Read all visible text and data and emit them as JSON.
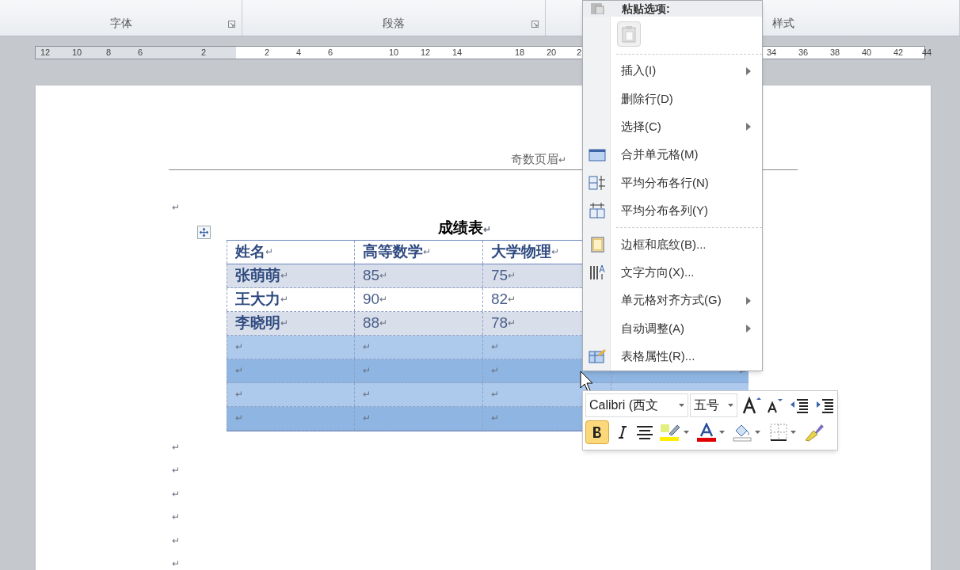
{
  "ribbon": {
    "groups": [
      {
        "label": "字体",
        "launcher": true
      },
      {
        "label": "段落",
        "launcher": true
      },
      {
        "label": "样式",
        "launcher": false
      }
    ]
  },
  "ruler": {
    "labels": [
      "12",
      "10",
      "8",
      "6",
      "2",
      "2",
      "4",
      "6",
      "10",
      "12",
      "14",
      "18",
      "20",
      "2",
      "34",
      "36",
      "38",
      "40",
      "42",
      "44"
    ]
  },
  "document": {
    "header": {
      "text": "奇数页眉",
      "mark": "↵"
    },
    "marks_before": [
      "↵"
    ],
    "table": {
      "title": "成绩表",
      "title_mark": "↵",
      "rows": [
        {
          "kind": "header",
          "selected": false,
          "cells": [
            {
              "text": "姓名",
              "mark": "↵"
            },
            {
              "text": "高等数学",
              "mark": "↵"
            },
            {
              "text": "大学物理",
              "mark": "↵"
            }
          ]
        },
        {
          "kind": "data",
          "selected": false,
          "cells": [
            {
              "text": "张萌萌",
              "mark": "↵"
            },
            {
              "text": "85",
              "mark": "↵"
            },
            {
              "text": "75",
              "mark": "↵"
            }
          ]
        },
        {
          "kind": "data",
          "selected": false,
          "cells": [
            {
              "text": "王大力",
              "mark": "↵"
            },
            {
              "text": "90",
              "mark": "↵"
            },
            {
              "text": "82",
              "mark": "↵"
            }
          ]
        },
        {
          "kind": "data",
          "selected": false,
          "cells": [
            {
              "text": "李晓明",
              "mark": "↵"
            },
            {
              "text": "88",
              "mark": "↵"
            },
            {
              "text": "78",
              "mark": "↵"
            }
          ]
        },
        {
          "kind": "data",
          "selected": true,
          "cells": [
            {
              "mark": "↵"
            },
            {
              "mark": "↵"
            },
            {
              "mark": "↵"
            }
          ]
        },
        {
          "kind": "data",
          "selected": true,
          "cells": [
            {
              "mark": "↵"
            },
            {
              "mark": "↵"
            },
            {
              "mark": "↵"
            }
          ],
          "end_mark": "↵"
        },
        {
          "kind": "data",
          "selected": true,
          "cells": [
            {
              "mark": "↵"
            },
            {
              "mark": "↵"
            },
            {
              "mark": "↵"
            }
          ]
        },
        {
          "kind": "data",
          "selected": true,
          "cells": [
            {
              "mark": "↵"
            },
            {
              "mark": "↵"
            },
            {
              "mark": "↵"
            }
          ]
        }
      ]
    },
    "marks_after": [
      "↵",
      "↵",
      "↵",
      "↵",
      "↵",
      "↵"
    ]
  },
  "context_menu": {
    "header": "粘贴选项:",
    "items": [
      {
        "kind": "separator"
      },
      {
        "kind": "item",
        "label": "插入(I)",
        "submenu": true
      },
      {
        "kind": "item",
        "label": "删除行(D)",
        "submenu": false
      },
      {
        "kind": "item",
        "label": "选择(C)",
        "submenu": true
      },
      {
        "kind": "merge",
        "label": "合并单元格(M)",
        "submenu": false
      },
      {
        "kind": "rows",
        "label": "平均分布各行(N)",
        "submenu": false
      },
      {
        "kind": "cols",
        "label": "平均分布各列(Y)",
        "submenu": false
      },
      {
        "kind": "separator"
      },
      {
        "kind": "border",
        "label": "边框和底纹(B)...",
        "submenu": false
      },
      {
        "kind": "direction",
        "label": "文字方向(X)...",
        "submenu": false
      },
      {
        "kind": "item",
        "label": "单元格对齐方式(G)",
        "submenu": true
      },
      {
        "kind": "item",
        "label": "自动调整(A)",
        "submenu": true
      },
      {
        "kind": "properties",
        "label": "表格属性(R)...",
        "submenu": false
      }
    ]
  },
  "mini_toolbar": {
    "font": "Calibri (西文",
    "size": "五号",
    "bold": {
      "selected": true
    },
    "italic": {
      "selected": false
    }
  }
}
